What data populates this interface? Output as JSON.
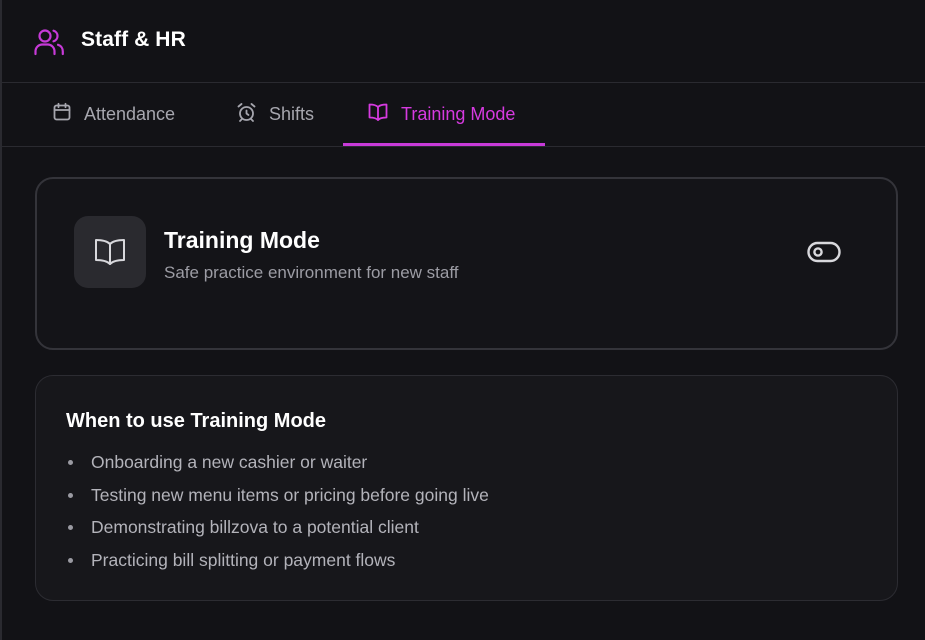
{
  "header": {
    "title": "Staff & HR",
    "icon": "users-icon"
  },
  "tabs": [
    {
      "label": "Attendance",
      "icon": "calendar-icon",
      "active": false
    },
    {
      "label": "Shifts",
      "icon": "alarm-clock-icon",
      "active": false
    },
    {
      "label": "Training Mode",
      "icon": "book-open-icon",
      "active": true
    }
  ],
  "mode_card": {
    "title": "Training Mode",
    "subtitle": "Safe practice environment for new staff",
    "icon": "book-open-icon",
    "toggle_on": false
  },
  "info_card": {
    "title": "When to use Training Mode",
    "items": [
      "Onboarding a new cashier or waiter",
      "Testing new menu items or pricing before going live",
      "Demonstrating billzova to a potential client",
      "Practicing bill splitting or payment flows"
    ]
  },
  "colors": {
    "accent": "#d63ae0",
    "background": "#121216",
    "card": "#141418",
    "muted_text": "#a6a6ae"
  }
}
